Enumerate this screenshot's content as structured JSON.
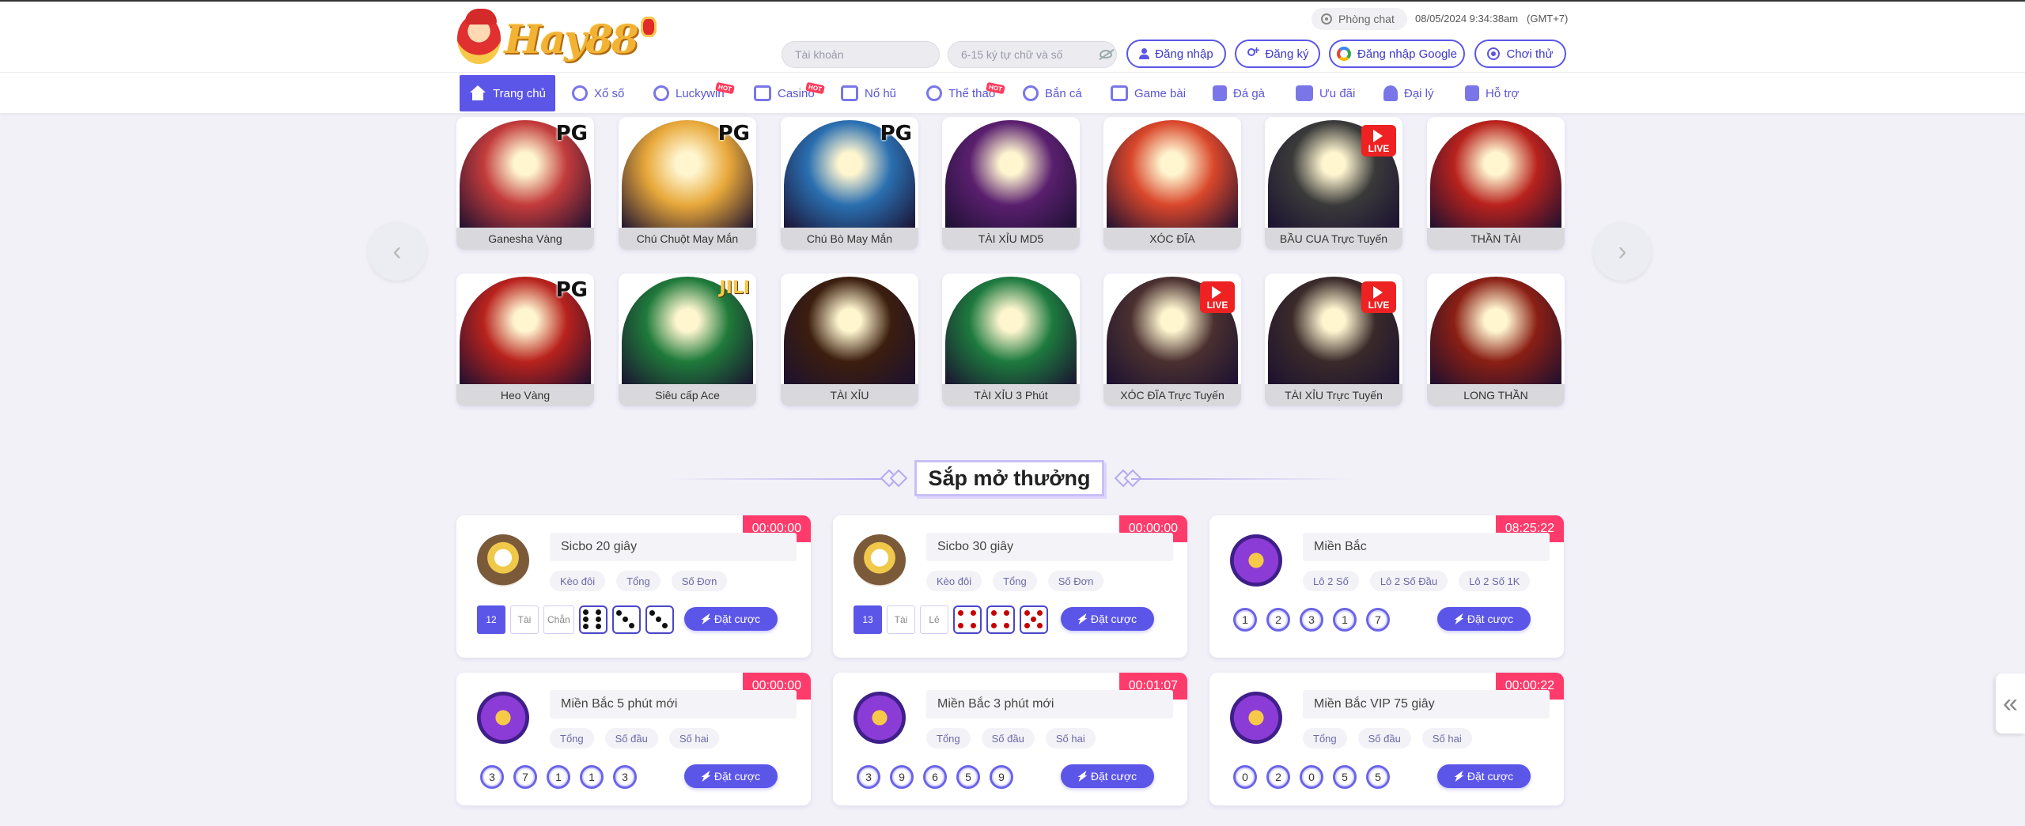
{
  "header": {
    "logo_text": "Hay88",
    "chat_label": "Phòng chat",
    "datetime": "08/05/2024 9:34:38am",
    "timezone": "(GMT+7)",
    "username_placeholder": "Tài khoản",
    "password_placeholder": "6-15 ký tự chữ và số",
    "login_label": "Đăng nhập",
    "register_label": "Đăng ký",
    "google_label": "Đăng nhập Google",
    "demo_label": "Chơi thử"
  },
  "nav": {
    "items": [
      {
        "label": "Trang chủ",
        "icon": "home-icon",
        "active": true
      },
      {
        "label": "Xổ số",
        "icon": "lottery-icon"
      },
      {
        "label": "Luckywin",
        "icon": "luckywin-icon",
        "hot": true
      },
      {
        "label": "Casino",
        "icon": "casino-icon",
        "hot": true
      },
      {
        "label": "Nổ hũ",
        "icon": "slot-icon"
      },
      {
        "label": "Thể thao",
        "icon": "sports-icon",
        "hot": true
      },
      {
        "label": "Bắn cá",
        "icon": "fish-icon"
      },
      {
        "label": "Game bài",
        "icon": "cards-icon"
      },
      {
        "label": "Đá gà",
        "icon": "rooster-icon"
      },
      {
        "label": "Ưu đãi",
        "icon": "gift-icon"
      },
      {
        "label": "Đại lý",
        "icon": "agent-icon"
      },
      {
        "label": "Hỗ trợ",
        "icon": "support-icon"
      }
    ],
    "hot_label": "HOT"
  },
  "games": [
    {
      "label": "Ganesha Vàng",
      "badge": "PG",
      "color": "#c23b3b"
    },
    {
      "label": "Chú Chuột May Mắn",
      "badge": "PG",
      "color": "#e8a83a"
    },
    {
      "label": "Chú Bò May Mắn",
      "badge": "PG",
      "color": "#2a6fb0"
    },
    {
      "label": "TÀI XỈU MD5",
      "badge": "",
      "color": "#5a1f6e"
    },
    {
      "label": "XÓC ĐĨA",
      "badge": "",
      "color": "#d9472b"
    },
    {
      "label": "BẦU CUA Trực Tuyến",
      "badge": "LIVE",
      "color": "#3a3a3a"
    },
    {
      "label": "THẦN TÀI",
      "badge": "",
      "color": "#b8221d"
    },
    {
      "label": "Heo Vàng",
      "badge": "PG",
      "color": "#b8221d"
    },
    {
      "label": "Siêu cấp Ace",
      "badge": "JILI",
      "color": "#1f7a3a"
    },
    {
      "label": "TÀI XỈU",
      "badge": "",
      "color": "#3c1e0e"
    },
    {
      "label": "TÀI XỈU 3 Phút",
      "badge": "",
      "color": "#1d7a3e"
    },
    {
      "label": "XÓC ĐĨA Trực Tuyến",
      "badge": "LIVE",
      "color": "#4a3030"
    },
    {
      "label": "TÀI XỈU Trực Tuyến",
      "badge": "LIVE",
      "color": "#3a2a2a"
    },
    {
      "label": "LONG THẦN",
      "badge": "",
      "color": "#8a1f14"
    }
  ],
  "section_title": "Sắp mở thưởng",
  "lotteries": [
    {
      "name": "Sicbo 20 giây",
      "timer": "00:00:00",
      "chips": [
        "Kèo đôi",
        "Tổng",
        "Số Đơn"
      ],
      "type": "sicbo",
      "total": "12",
      "tags": [
        "Tài",
        "Chẵn"
      ],
      "dice": [
        6,
        3,
        3
      ],
      "red": false
    },
    {
      "name": "Sicbo 30 giây",
      "timer": "00:00:00",
      "chips": [
        "Kèo đôi",
        "Tổng",
        "Số Đơn"
      ],
      "type": "sicbo",
      "total": "13",
      "tags": [
        "Tài",
        "Lẻ"
      ],
      "dice": [
        4,
        4,
        5
      ],
      "red": true
    },
    {
      "name": "Miền Bắc",
      "timer": "08:25:22",
      "chips": [
        "Lô 2 Số",
        "Lô 2 Số Đầu",
        "Lô 2 Số 1K"
      ],
      "type": "balls",
      "balls": [
        "1",
        "2",
        "3",
        "1",
        "7"
      ]
    },
    {
      "name": "Miền Bắc 5 phút mới",
      "timer": "00:00:00",
      "chips": [
        "Tổng",
        "Số đầu",
        "Số hai"
      ],
      "type": "balls",
      "balls": [
        "3",
        "7",
        "1",
        "1",
        "3"
      ]
    },
    {
      "name": "Miền Bắc 3 phút mới",
      "timer": "00:01:07",
      "chips": [
        "Tổng",
        "Số đầu",
        "Số hai"
      ],
      "type": "balls",
      "balls": [
        "3",
        "9",
        "6",
        "5",
        "9"
      ]
    },
    {
      "name": "Miền Bắc VIP 75 giây",
      "timer": "00:00:22",
      "chips": [
        "Tổng",
        "Số đầu",
        "Số hai"
      ],
      "type": "balls",
      "balls": [
        "0",
        "2",
        "0",
        "5",
        "5"
      ]
    }
  ],
  "bet_label": "Đặt cược"
}
